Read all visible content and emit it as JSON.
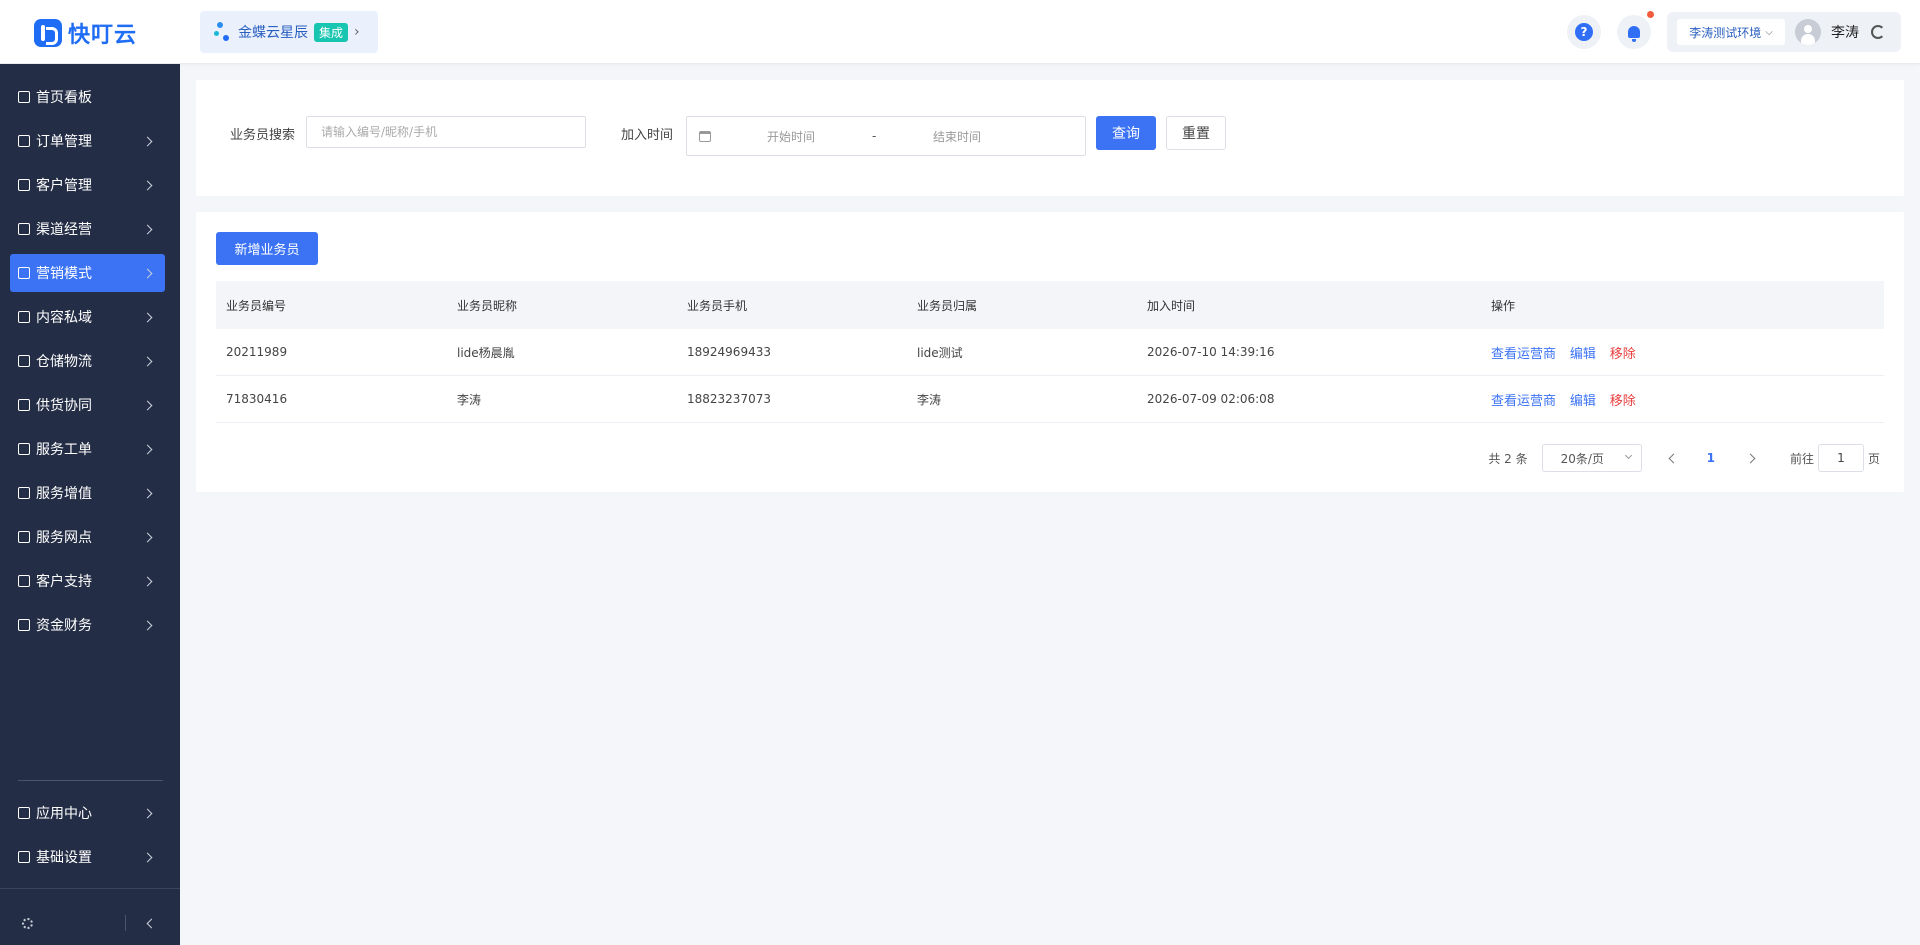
{
  "header": {
    "logo_text": "快叮云",
    "app_name": "金蝶云星辰",
    "app_badge": "集成",
    "help_label": "?",
    "env_label": "李涛测试环境",
    "user_name": "李涛"
  },
  "sidebar": {
    "items": [
      {
        "label": "首页看板",
        "icon": "home-icon",
        "has_children": false
      },
      {
        "label": "订单管理",
        "icon": "order-icon",
        "has_children": true
      },
      {
        "label": "客户管理",
        "icon": "user-icon",
        "has_children": true
      },
      {
        "label": "渠道经营",
        "icon": "channel-icon",
        "has_children": true
      },
      {
        "label": "营销模式",
        "icon": "tag-icon",
        "has_children": true,
        "active": true
      },
      {
        "label": "内容私域",
        "icon": "image-icon",
        "has_children": true
      },
      {
        "label": "仓储物流",
        "icon": "box-icon",
        "has_children": true
      },
      {
        "label": "供货协同",
        "icon": "supply-icon",
        "has_children": true
      },
      {
        "label": "服务工单",
        "icon": "ticket-icon",
        "has_children": true
      },
      {
        "label": "服务增值",
        "icon": "bag-icon",
        "has_children": true
      },
      {
        "label": "服务网点",
        "icon": "store-icon",
        "has_children": true
      },
      {
        "label": "客户支持",
        "icon": "support-icon",
        "has_children": true
      },
      {
        "label": "资金财务",
        "icon": "yen-icon",
        "has_children": true
      }
    ],
    "bottom_items": [
      {
        "label": "应用中心",
        "icon": "cube-icon"
      },
      {
        "label": "基础设置",
        "icon": "settings-list-icon"
      }
    ]
  },
  "search": {
    "salesman_label": "业务员搜索",
    "salesman_placeholder": "请输入编号/昵称/手机",
    "join_time_label": "加入时间",
    "start_placeholder": "开始时间",
    "separator": "-",
    "end_placeholder": "结束时间",
    "query_label": "查询",
    "reset_label": "重置"
  },
  "list": {
    "add_label": "新增业务员",
    "columns": [
      "业务员编号",
      "业务员昵称",
      "业务员手机",
      "业务员归属",
      "加入时间",
      "操作"
    ],
    "rows": [
      {
        "id": "20211989",
        "nickname": "lide杨晨胤",
        "phone": "18924969433",
        "owner": "lide测试",
        "joined": "2026-07-10 14:39:16"
      },
      {
        "id": "71830416",
        "nickname": "李涛",
        "phone": "18823237073",
        "owner": "李涛",
        "joined": "2026-07-09 02:06:08"
      }
    ],
    "actions": {
      "view": "查看运营商",
      "edit": "编辑",
      "remove": "移除"
    }
  },
  "pager": {
    "total_text": "共 2 条",
    "page_size": "20条/页",
    "current_page": "1",
    "goto_label": "前往",
    "goto_value": "1",
    "page_suffix": "页"
  },
  "colors": {
    "primary": "#3c73f5",
    "sidebar_bg": "#232d45",
    "danger": "#e83d3d",
    "badge": "#18c5b0"
  }
}
